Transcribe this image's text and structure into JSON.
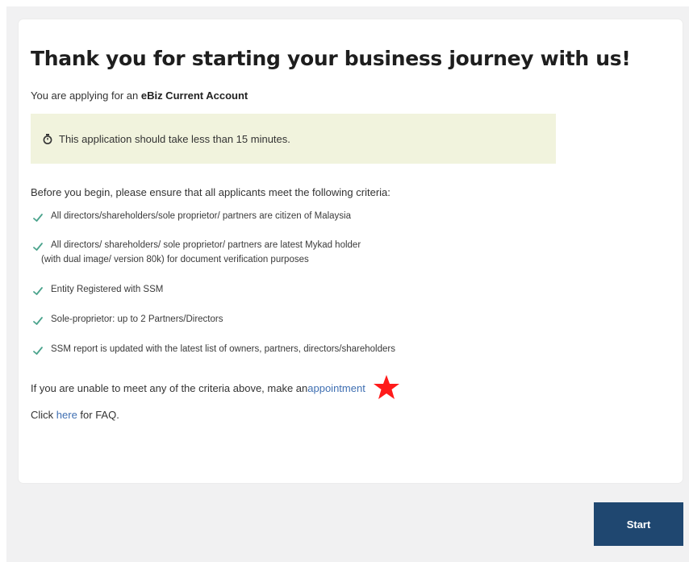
{
  "heading": {
    "title": "Thank you for starting your business journey with us!"
  },
  "subtitle": {
    "prefix": "You are applying for an ",
    "product": "eBiz Current Account"
  },
  "info": {
    "icon": "stopwatch-icon",
    "text": "This application should take less than 15 minutes."
  },
  "criteria": {
    "intro": "Before you begin, please ensure that all applicants meet the following criteria:",
    "items": [
      {
        "line1": "All directors/shareholders/sole proprietor/ partners are citizen of Malaysia",
        "line2": ""
      },
      {
        "line1": "All directors/ shareholders/ sole proprietor/ partners are latest Mykad holder",
        "line2": "(with dual image/ version 80k) for document verification purposes"
      },
      {
        "line1": "Entity Registered with SSM",
        "line2": ""
      },
      {
        "line1": "Sole-proprietor: up to 2 Partners/Directors",
        "line2": ""
      },
      {
        "line1": "SSM report is updated with the latest list of owners, partners, directors/shareholders",
        "line2": ""
      }
    ],
    "check_color": "#4aa38c"
  },
  "appointment": {
    "prefix": "If you are unable to meet any of the criteria above, make an ",
    "link_text": "appointment",
    "star_color": "#ff1a1a"
  },
  "faq": {
    "prefix": "Click ",
    "link_text": "here",
    "suffix": " for FAQ."
  },
  "actions": {
    "start_label": "Start",
    "button_color": "#1f4770"
  }
}
